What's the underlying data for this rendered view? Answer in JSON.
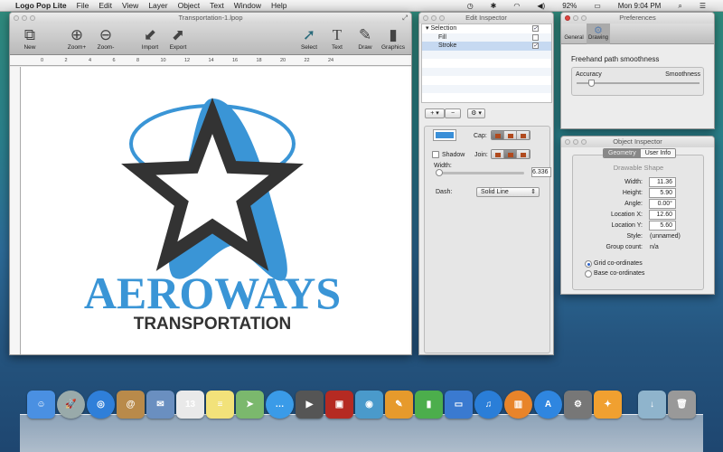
{
  "menubar": {
    "app": "Logo Pop Lite",
    "items": [
      "File",
      "Edit",
      "View",
      "Layer",
      "Object",
      "Text",
      "Window",
      "Help"
    ],
    "battery": "92%",
    "clock": "Mon 9:04 PM"
  },
  "document": {
    "title": "Transportation-1.lpop",
    "toolbar": [
      "New",
      "Zoom+",
      "Zoom-",
      "Import",
      "Export",
      "Select",
      "Text",
      "Draw",
      "Graphics"
    ],
    "ruler": [
      "0",
      "2",
      "4",
      "6",
      "8",
      "10",
      "12",
      "14",
      "16",
      "18",
      "20",
      "22",
      "24"
    ],
    "logo": {
      "main": "AEROWAYS",
      "sub": "TRANSPORTATION",
      "blue": "#3a95d6",
      "dark": "#333333"
    }
  },
  "edit_inspector": {
    "title": "Edit Inspector",
    "rows": [
      {
        "label": "Selection",
        "checked": true
      },
      {
        "label": "Fill",
        "checked": false
      },
      {
        "label": "Stroke",
        "checked": true
      }
    ],
    "add": "+ ▾",
    "remove": "−",
    "gear": "⚙ ▾",
    "cap": "Cap:",
    "shadow": "Shadow",
    "join": "Join:",
    "width_label": "Width:",
    "width_value": "6.336",
    "dash_label": "Dash:",
    "dash_value": "Solid Line",
    "stroke_color": "#3a8fd8"
  },
  "preferences": {
    "title": "Preferences",
    "tabs": [
      "General",
      "Drawing"
    ],
    "heading": "Freehand path smoothness",
    "left": "Accuracy",
    "right": "Smoothness",
    "slider_fraction": 0.12
  },
  "object_inspector": {
    "title": "Object Inspector",
    "tabs": [
      "Geometry",
      "User Info"
    ],
    "heading": "Drawable Shape",
    "fields": [
      {
        "label": "Width:",
        "value": "11.36"
      },
      {
        "label": "Height:",
        "value": "5.90"
      },
      {
        "label": "Angle:",
        "value": "0.00°"
      },
      {
        "label": "Location X:",
        "value": "12.60"
      },
      {
        "label": "Location Y:",
        "value": "5.60"
      }
    ],
    "style_label": "Style:",
    "style_value": "(unnamed)",
    "group_label": "Group count:",
    "group_value": "n/a",
    "radio1": "Grid co-ordinates",
    "radio2": "Base co-ordinates"
  },
  "dock": [
    {
      "name": "finder",
      "c": "#4a90e2",
      "g": "☺"
    },
    {
      "name": "launchpad",
      "c": "#9aa",
      "g": "🚀"
    },
    {
      "name": "safari",
      "c": "#2f7fd9",
      "g": "◎"
    },
    {
      "name": "contacts",
      "c": "#b98a4a",
      "g": "@"
    },
    {
      "name": "mail",
      "c": "#6a8fc0",
      "g": "✉"
    },
    {
      "name": "calendar",
      "c": "#e9e9e9",
      "g": "13"
    },
    {
      "name": "notes",
      "c": "#f2e27a",
      "g": "≡"
    },
    {
      "name": "maps",
      "c": "#7bb86d",
      "g": "➤"
    },
    {
      "name": "messages",
      "c": "#3a9be8",
      "g": "…"
    },
    {
      "name": "facetime",
      "c": "#555",
      "g": "▶"
    },
    {
      "name": "photo-booth",
      "c": "#b52a22",
      "g": "▣"
    },
    {
      "name": "iphoto",
      "c": "#4a9acb",
      "g": "◉"
    },
    {
      "name": "pages",
      "c": "#e69a2c",
      "g": "✎"
    },
    {
      "name": "numbers",
      "c": "#4cae4c",
      "g": "▮"
    },
    {
      "name": "keynote",
      "c": "#3a7ad0",
      "g": "▭"
    },
    {
      "name": "itunes",
      "c": "#2a7ed8",
      "g": "♫"
    },
    {
      "name": "ibooks",
      "c": "#e8842a",
      "g": "▥"
    },
    {
      "name": "app-store",
      "c": "#2f86e0",
      "g": "A"
    },
    {
      "name": "system-preferences",
      "c": "#777",
      "g": "⚙"
    },
    {
      "name": "logo-pop",
      "c": "#f0a030",
      "g": "✦"
    },
    {
      "name": "downloads",
      "c": "#8fb4cc",
      "g": "↓"
    },
    {
      "name": "trash",
      "c": "#999",
      "g": "🗑"
    }
  ]
}
